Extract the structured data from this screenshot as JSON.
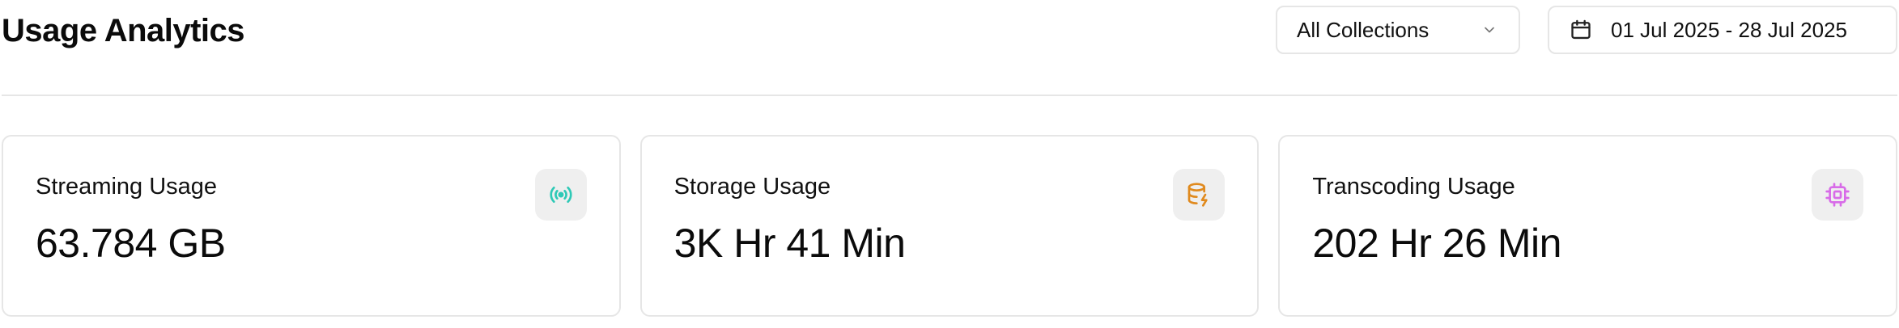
{
  "header": {
    "title": "Usage Analytics",
    "collection_select": {
      "value": "All Collections",
      "icon": "chevron-down-icon"
    },
    "date_range": {
      "value": "01 Jul 2025 - 28 Jul 2025",
      "icon": "calendar-icon"
    }
  },
  "cards": [
    {
      "title": "Streaming Usage",
      "value": "63.784 GB",
      "icon": "broadcast-icon",
      "icon_color": "#2EC9B6"
    },
    {
      "title": "Storage Usage",
      "value": "3K Hr 41 Min",
      "icon": "database-bolt-icon",
      "icon_color": "#E08A1E"
    },
    {
      "title": "Transcoding Usage",
      "value": "202 Hr 26 Min",
      "icon": "cpu-chip-icon",
      "icon_color": "#D86BE8"
    }
  ],
  "colors": {
    "border": "#E6E6E6",
    "icon_badge_bg": "#EFEFEF",
    "text": "#111111"
  }
}
